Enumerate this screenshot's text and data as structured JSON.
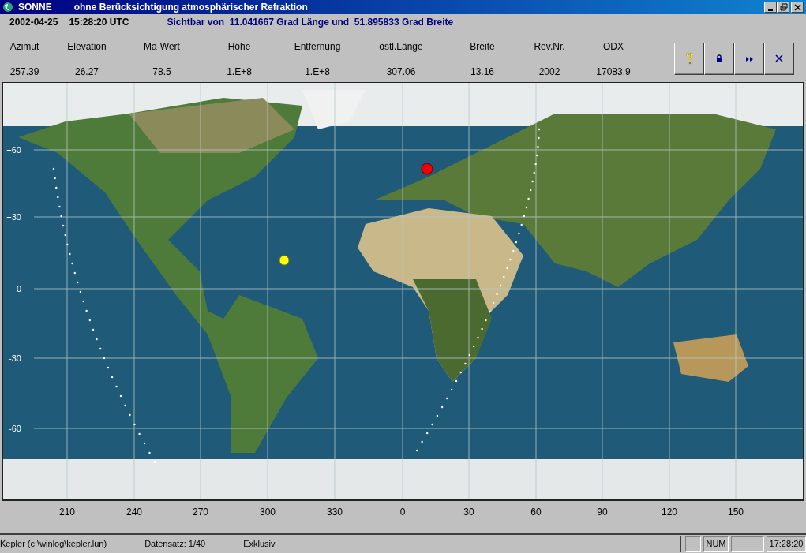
{
  "window": {
    "title": "SONNE",
    "subtitle": "ohne Berücksichtigung atmosphärischer Refraktion"
  },
  "info": {
    "date": "2002-04-25",
    "time": "15:28:20 UTC",
    "location": "Sichtbar von  11.041667 Grad Länge und  51.895833 Grad Breite"
  },
  "readings": [
    {
      "label": "Azimut",
      "value": "257.39"
    },
    {
      "label": "Elevation",
      "value": "26.27"
    },
    {
      "label": "Ma-Wert",
      "value": "78.5"
    },
    {
      "label": "Höhe",
      "value": "1.E+8"
    },
    {
      "label": "Entfernung",
      "value": "1.E+8"
    },
    {
      "label": "östl.Länge",
      "value": "307.06"
    },
    {
      "label": "Breite",
      "value": "13.16"
    },
    {
      "label": "Rev.Nr.",
      "value": "2002"
    },
    {
      "label": "ODX",
      "value": "17083.9"
    }
  ],
  "toolbar": [
    {
      "kind": "help"
    },
    {
      "kind": "lock"
    },
    {
      "kind": "forward"
    },
    {
      "kind": "close"
    }
  ],
  "map": {
    "lat_labels": [
      "+60",
      "+30",
      "0",
      "-30",
      "-60"
    ],
    "lon_labels": [
      "210",
      "240",
      "270",
      "300",
      "330",
      "0",
      "30",
      "60",
      "90",
      "120",
      "150"
    ]
  },
  "status_bar": {
    "file": "Kepler (c:\\winlog\\kepler.lun)",
    "record": "Datensatz: 1/40",
    "mode": "Exklusiv",
    "panels": [
      {
        "kind": "blank"
      },
      {
        "kind": "text",
        "text": "NUM"
      },
      {
        "kind": "blank"
      },
      {
        "kind": "text",
        "text": "17:28:20"
      }
    ]
  }
}
